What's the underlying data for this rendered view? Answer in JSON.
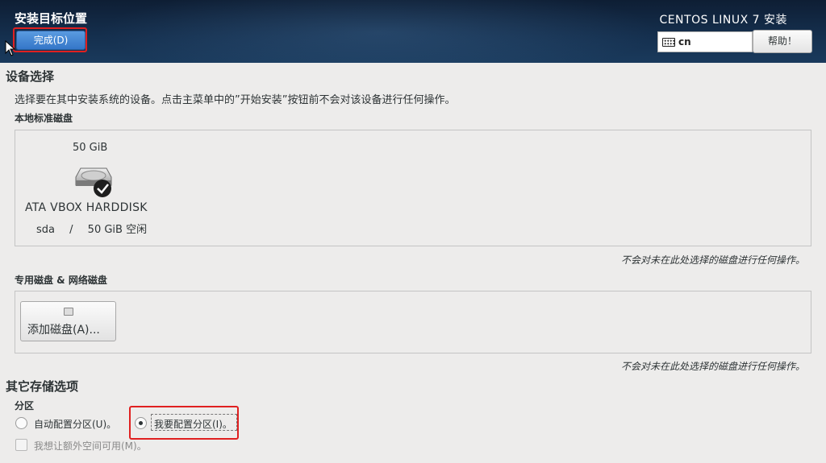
{
  "header": {
    "title": "安装目标位置",
    "done_label": "完成(D)",
    "product": "CENTOS LINUX 7 安装",
    "keyboard_layout": "cn",
    "help_label": "帮助！"
  },
  "device_selection": {
    "title": "设备选择",
    "description": "选择要在其中安装系统的设备。点击主菜单中的”开始安装”按钮前不会对该设备进行任何操作。",
    "local_label": "本地标准磁盘",
    "disks": [
      {
        "size": "50 GiB",
        "name": "ATA VBOX HARDDISK",
        "device": "sda",
        "separator": "/",
        "free": "50 GiB 空闲",
        "selected": true
      }
    ],
    "local_note": "不会对未在此处选择的磁盘进行任何操作。",
    "specialized_label": "专用磁盘 & 网络磁盘",
    "add_disk_label": "添加磁盘(A)...",
    "specialized_note": "不会对未在此处选择的磁盘进行任何操作。"
  },
  "other_storage": {
    "title": "其它存储选项",
    "partition_label": "分区",
    "auto_option": "自动配置分区(U)。",
    "manual_option": "我要配置分区(I)。",
    "manual_selected": true,
    "extra_space_option": "我想让额外空间可用(M)。"
  },
  "colors": {
    "header_bg": "#15304f",
    "done_button": "#3476c8",
    "highlight": "#e02020",
    "body_bg": "#edeceb"
  }
}
